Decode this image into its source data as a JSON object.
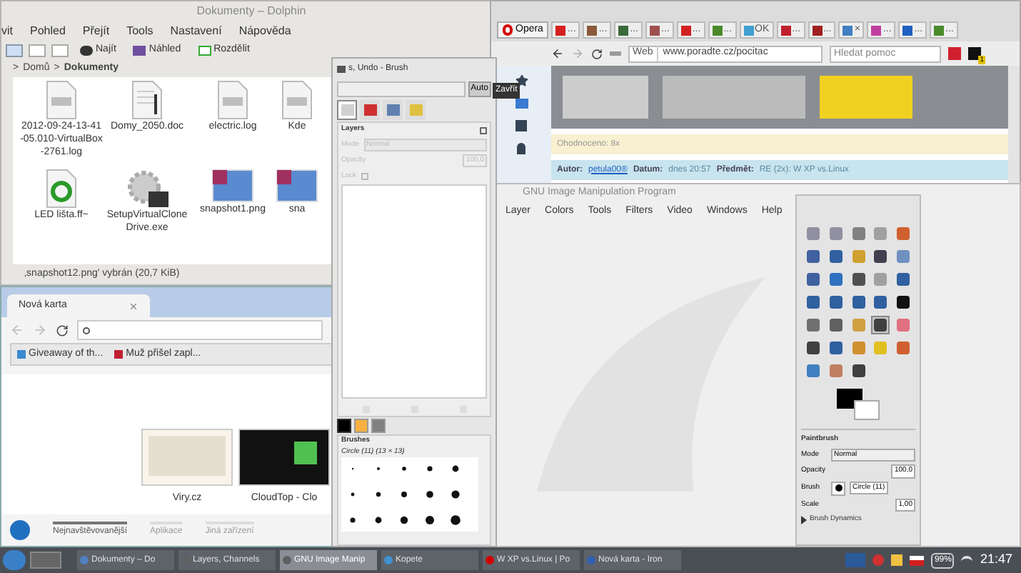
{
  "dolphin": {
    "title": "Dokumenty – Dolphin",
    "menu": [
      "vit",
      "Pohled",
      "Přejít",
      "Tools",
      "Nastavení",
      "Nápověda"
    ],
    "toolbar": [
      {
        "label": "Najít",
        "kind": "find"
      },
      {
        "label": "Náhled",
        "kind": "preview"
      },
      {
        "label": "Rozdělit",
        "kind": "split"
      }
    ],
    "separator": ">",
    "breadcrumb": [
      "Domů",
      "Dokumenty"
    ],
    "files": [
      {
        "name": "2012-09-24-13-41-05.010-VirtualBox-2761.log",
        "kind": "log"
      },
      {
        "name": "Domy_2050.doc",
        "kind": "doc"
      },
      {
        "name": "electric.log",
        "kind": "log"
      },
      {
        "name": "Kde",
        "kind": "log"
      },
      {
        "name": "LED lišta.ff~",
        "kind": "recycle"
      },
      {
        "name": "SetupVirtualCloneDrive.exe",
        "kind": "exe"
      },
      {
        "name": "snapshot1.png",
        "kind": "image"
      },
      {
        "name": "sna",
        "kind": "image"
      }
    ],
    "status": "‚snapshot12.png' vybrán (20,7 KiB)"
  },
  "opera": {
    "tabs": [
      {
        "label": "Opera",
        "kind": "menu",
        "color": "#d40000"
      },
      {
        "label": "...",
        "kind": "tab",
        "color": "#d42020"
      },
      {
        "label": "...",
        "kind": "tab",
        "color": "#8a5a3a"
      },
      {
        "label": "...",
        "kind": "tab",
        "color": "#3a6a3a"
      },
      {
        "label": "...",
        "kind": "tab",
        "color": "#a05050"
      },
      {
        "label": "...",
        "kind": "tab",
        "color": "#d42020"
      },
      {
        "label": "...",
        "kind": "tab",
        "color": "#4a8a2a"
      },
      {
        "label": "OK",
        "kind": "tab",
        "color": "#40a0d0"
      },
      {
        "label": "...",
        "kind": "tab",
        "color": "#c02030"
      },
      {
        "label": "...",
        "kind": "tab",
        "color": "#a02020"
      },
      {
        "label": "×",
        "kind": "tab",
        "color": "#4080c0"
      },
      {
        "label": "...",
        "kind": "tab",
        "color": "#c040a0"
      },
      {
        "label": "...",
        "kind": "tab",
        "color": "#2060c0"
      },
      {
        "label": "...",
        "kind": "tab",
        "color": "#4a8a2a"
      }
    ],
    "web_label": "Web",
    "address": "www.poradte.cz/pocitac",
    "search_placeholder": "Hledat pomoc",
    "badge": "1",
    "rating": "Ohodnoceno: 8x",
    "post": [
      {
        "label": "Autor:",
        "value": "petula00®",
        "link": true
      },
      {
        "label": "Datum:",
        "value": "dnes 20:57",
        "link": false
      },
      {
        "label": "Předmět:",
        "value": "RE (2x): W XP vs.Linux",
        "link": false
      }
    ]
  },
  "gimp": {
    "title": "GNU Image Manipulation Program",
    "menu": [
      "Layer",
      "Colors",
      "Tools",
      "Filters",
      "Video",
      "Windows",
      "Help"
    ]
  },
  "iron": {
    "tab": "Nová karta",
    "bookmarks": [
      {
        "label": "Giveaway of th...",
        "color": "#3a8ad0"
      },
      {
        "label": "Muž přišel zapl...",
        "color": "#c02030"
      }
    ],
    "thumbnails": [
      {
        "label": "Viry.cz",
        "kind": "page"
      },
      {
        "label": "CloudTop - Clo",
        "kind": "dark"
      }
    ],
    "sections": [
      {
        "label": "Nejnavštěvovanější",
        "selected": true
      },
      {
        "label": "Aplikace",
        "selected": false
      },
      {
        "label": "Jiná zařízení",
        "selected": false
      }
    ]
  },
  "dock": {
    "title": "s, Undo - Brush",
    "auto": "Auto",
    "tooltip": "Zavřít",
    "tabs": [
      {
        "selected": true,
        "color": "#d0d0d0"
      },
      {
        "selected": false,
        "color": "#d03030"
      },
      {
        "selected": false,
        "color": "#6080b0"
      },
      {
        "selected": false,
        "color": "#e0c040"
      }
    ],
    "layers_title": "Layers",
    "mode_label": "Mode",
    "mode": "Normal",
    "opacity_label": "Opacity",
    "opacity": "100,0",
    "lock_label": "Lock",
    "lock_checked": false,
    "brush_tabs": [
      {
        "selected": true,
        "color": "#000000"
      },
      {
        "selected": false,
        "color": "#f5b040"
      },
      {
        "selected": false,
        "color": "#808080"
      }
    ],
    "brushes_title": "Brushes",
    "brush_name": "Circle (11) (13 × 13)"
  },
  "toolbox": {
    "tools": [
      {
        "selected": false,
        "color": "#9090a0"
      },
      {
        "selected": false,
        "color": "#9090a0"
      },
      {
        "selected": false,
        "color": "#808080"
      },
      {
        "selected": false,
        "color": "#a0a0a0"
      },
      {
        "selected": false,
        "color": "#d06030"
      },
      {
        "selected": false,
        "color": "#4060a0"
      },
      {
        "selected": false,
        "color": "#3060a0"
      },
      {
        "selected": false,
        "color": "#d0a030"
      },
      {
        "selected": false,
        "color": "#404050"
      },
      {
        "selected": false,
        "color": "#7090c0"
      },
      {
        "selected": false,
        "color": "#4060a0"
      },
      {
        "selected": false,
        "color": "#3070c0"
      },
      {
        "selected": false,
        "color": "#505050"
      },
      {
        "selected": false,
        "color": "#a0a0a0"
      },
      {
        "selected": false,
        "color": "#3060a0"
      },
      {
        "selected": false,
        "color": "#3060a0"
      },
      {
        "selected": false,
        "color": "#3060a0"
      },
      {
        "selected": false,
        "color": "#3060a0"
      },
      {
        "selected": false,
        "color": "#3060a0"
      },
      {
        "selected": false,
        "color": "#111111"
      },
      {
        "selected": false,
        "color": "#707070"
      },
      {
        "selected": false,
        "color": "#606060"
      },
      {
        "selected": false,
        "color": "#d0a040"
      },
      {
        "selected": true,
        "color": "#404040"
      },
      {
        "selected": false,
        "color": "#e07080"
      },
      {
        "selected": false,
        "color": "#404040"
      },
      {
        "selected": false,
        "color": "#3060a0"
      },
      {
        "selected": false,
        "color": "#d09030"
      },
      {
        "selected": false,
        "color": "#e0c020"
      },
      {
        "selected": false,
        "color": "#d06030"
      },
      {
        "selected": false,
        "color": "#4080c0"
      },
      {
        "selected": false,
        "color": "#c08060"
      },
      {
        "selected": false,
        "color": "#404040"
      }
    ],
    "tool_name": "Paintbrush",
    "mode_label": "Mode",
    "mode": "Normal",
    "opacity_label": "Opacity",
    "opacity": "100,0",
    "brush_label": "Brush",
    "brush": "Circle (11)",
    "scale_label": "Scale",
    "scale": "1,00",
    "dynamics": "Brush Dynamics"
  },
  "taskbar": {
    "tasks": [
      {
        "label": "Dokumenty – Do",
        "selected": false,
        "color": "#5080c0"
      },
      {
        "label": "Layers, Channels",
        "selected": false,
        "color": "#606060"
      },
      {
        "label": "GNU Image Manip",
        "selected": true,
        "color": "#606060"
      },
      {
        "label": "Kopete",
        "selected": false,
        "color": "#4090d0"
      },
      {
        "label": "W XP vs.Linux | Po",
        "selected": false,
        "color": "#d00000"
      },
      {
        "label": "Nová karta - Iron",
        "selected": false,
        "color": "#3060b0"
      }
    ],
    "battery": "99%",
    "clock": "21:47"
  }
}
